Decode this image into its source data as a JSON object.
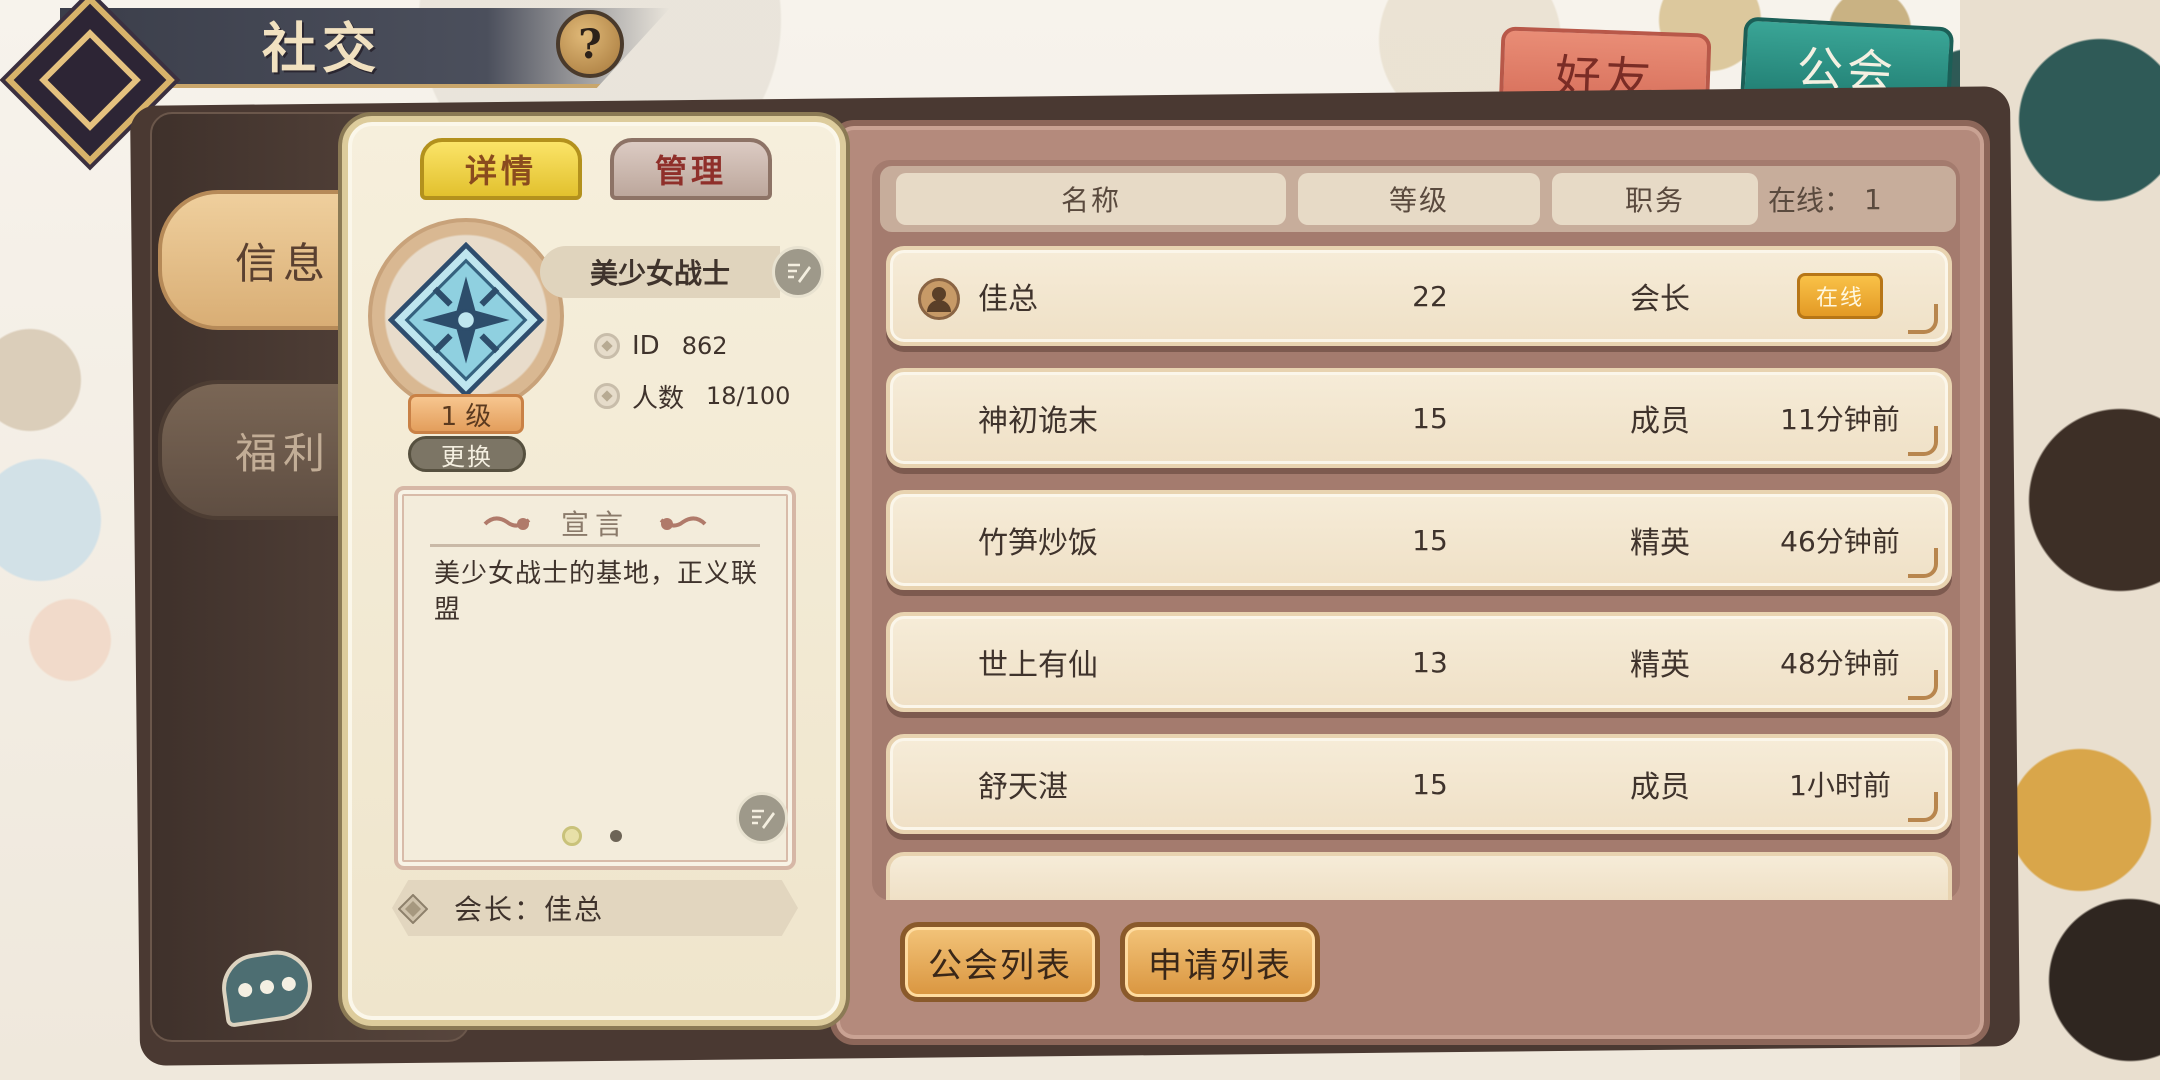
{
  "header": {
    "title": "社交",
    "help_label": "?"
  },
  "top_tabs": {
    "friends": "好友",
    "guild": "公会"
  },
  "side_nav": {
    "info": "信息",
    "welfare": "福利"
  },
  "detail_card": {
    "tabs": {
      "detail": "详情",
      "manage": "管理"
    },
    "guild_name": "美少女战士",
    "level": "1 级",
    "change_label": "更换",
    "id_label": "ID",
    "id_value": "862",
    "members_label": "人数",
    "members_value": "18/100",
    "declaration_title": "宣言",
    "declaration_text": "美少女战士的基地，正义联盟",
    "leader_label": "会长：佳总",
    "page_count": 2,
    "page_current": 1
  },
  "member_list": {
    "headers": {
      "name": "名称",
      "level": "等级",
      "role": "职务",
      "online_label": "在线：",
      "online_count": "1"
    },
    "rows": [
      {
        "name": "佳总",
        "level": "22",
        "role": "会长",
        "status": "在线",
        "online": true,
        "leader_icon": "crown-person-icon"
      },
      {
        "name": "神初诡末",
        "level": "15",
        "role": "成员",
        "status": "11分钟前",
        "online": false
      },
      {
        "name": "竹笋炒饭",
        "level": "15",
        "role": "精英",
        "status": "46分钟前",
        "online": false
      },
      {
        "name": "世上有仙",
        "level": "13",
        "role": "精英",
        "status": "48分钟前",
        "online": false
      },
      {
        "name": "舒天湛",
        "level": "15",
        "role": "成员",
        "status": "1小时前",
        "online": false
      }
    ]
  },
  "bottom_buttons": {
    "guild_list": "公会列表",
    "apply_list": "申请列表"
  },
  "colors": {
    "accent_gold": "#e2c12e",
    "tab_friends": "#d56c58",
    "tab_guild": "#1f7b70",
    "online_badge": "#f0a934",
    "panel_brown": "#b48a7c"
  },
  "icons": {
    "chat": "chat-bubble-icon",
    "edit": "edit-pencil-icon",
    "emblem": "guild-emblem-icon"
  }
}
